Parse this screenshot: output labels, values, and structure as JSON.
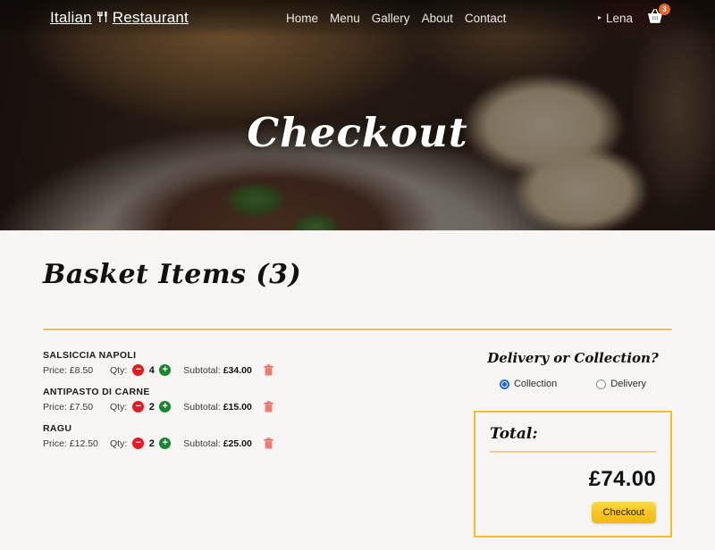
{
  "navbar": {
    "brand_left": "Italian",
    "brand_icon": "fork-knife-icon",
    "brand_icon_glyph": "🍴",
    "brand_right": "Restaurant",
    "links": [
      {
        "label": "Home"
      },
      {
        "label": "Menu"
      },
      {
        "label": "Gallery"
      },
      {
        "label": "About"
      },
      {
        "label": "Contact"
      }
    ],
    "user": {
      "name": "Lena",
      "caret": "▸"
    },
    "cart": {
      "icon": "shopping-basket-icon",
      "badge_count": "3",
      "badge_color": "#e8622a"
    }
  },
  "hero": {
    "title": "Checkout"
  },
  "main": {
    "heading": "Basket Items (3)",
    "divider_color": "#e0bf7d",
    "basket": {
      "price_label": "Price:",
      "qty_label": "Qty:",
      "subtotal_label": "Subtotal:",
      "decrement_glyph": "−",
      "increment_glyph": "+",
      "delete_icon": "trash-icon",
      "items": [
        {
          "name": "SALSICCIA NAPOLI",
          "price": "£8.50",
          "qty": "4",
          "subtotal": "£34.00"
        },
        {
          "name": "ANTIPASTO DI CARNE",
          "price": "£7.50",
          "qty": "2",
          "subtotal": "£15.00"
        },
        {
          "name": "RAGU",
          "price": "£12.50",
          "qty": "2",
          "subtotal": "£25.00"
        }
      ]
    },
    "delivery": {
      "title": "Delivery or Collection?",
      "options": [
        {
          "label": "Collection",
          "selected": true
        },
        {
          "label": "Delivery",
          "selected": false
        }
      ]
    },
    "total": {
      "label": "Total:",
      "amount": "£74.00",
      "checkout_label": "Checkout",
      "border_color": "#f0c124"
    }
  }
}
